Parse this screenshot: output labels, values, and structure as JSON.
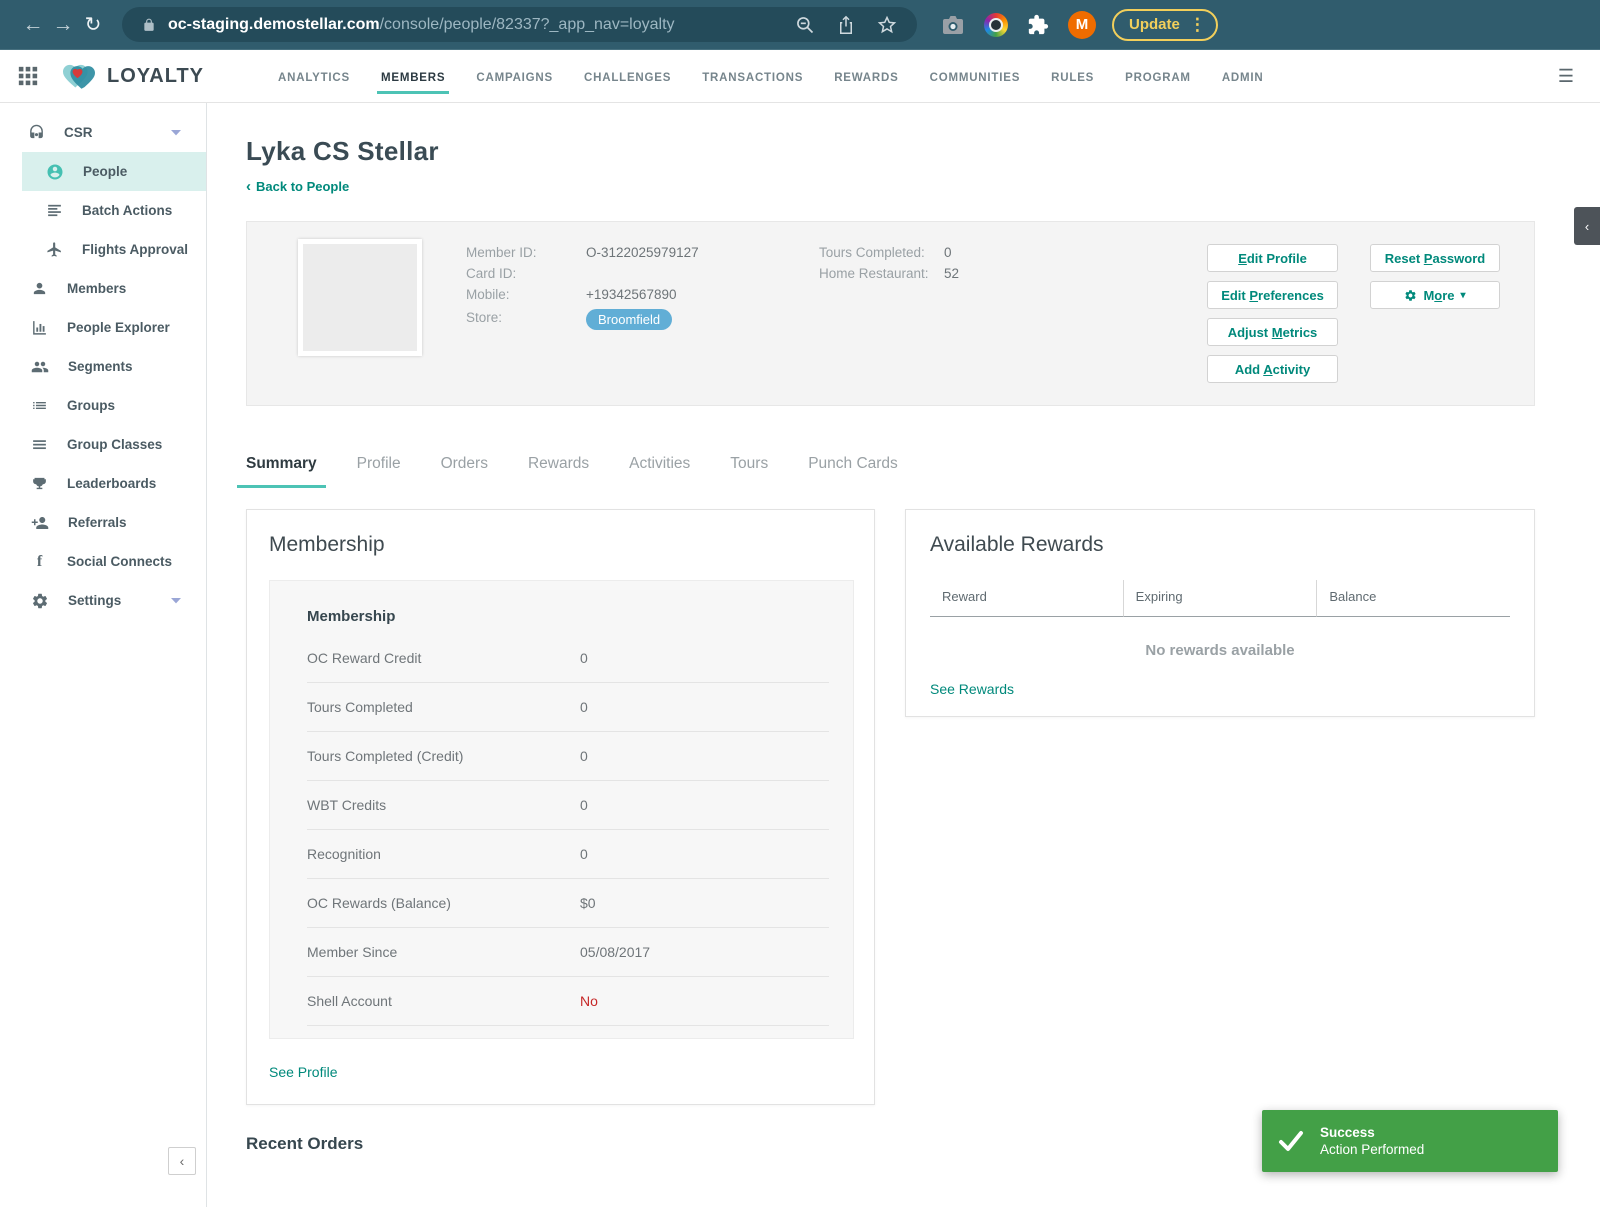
{
  "browser": {
    "url": {
      "domain": "oc-staging.demostellar.com",
      "path": "/console/people/82337?_app_nav=loyalty"
    },
    "profile_initial": "M",
    "update_label": "Update"
  },
  "appbar": {
    "brand": "LOYALTY",
    "nav": [
      {
        "label": "ANALYTICS"
      },
      {
        "label": "MEMBERS"
      },
      {
        "label": "CAMPAIGNS"
      },
      {
        "label": "CHALLENGES"
      },
      {
        "label": "TRANSACTIONS"
      },
      {
        "label": "REWARDS"
      },
      {
        "label": "COMMUNITIES"
      },
      {
        "label": "RULES"
      },
      {
        "label": "PROGRAM"
      },
      {
        "label": "ADMIN"
      }
    ]
  },
  "sidebar": {
    "items": [
      {
        "label": "CSR"
      },
      {
        "label": "People"
      },
      {
        "label": "Batch Actions"
      },
      {
        "label": "Flights Approval"
      },
      {
        "label": "Members"
      },
      {
        "label": "People Explorer"
      },
      {
        "label": "Segments"
      },
      {
        "label": "Groups"
      },
      {
        "label": "Group Classes"
      },
      {
        "label": "Leaderboards"
      },
      {
        "label": "Referrals"
      },
      {
        "label": "Social Connects"
      },
      {
        "label": "Settings"
      }
    ]
  },
  "page": {
    "title": "Lyka CS Stellar",
    "back_link": "Back to People"
  },
  "member": {
    "fields": [
      {
        "label": "Member ID:",
        "value": "O-3122025979127"
      },
      {
        "label": "Card ID:",
        "value": ""
      },
      {
        "label": "Mobile:",
        "value": "+19342567890"
      },
      {
        "label": "Store:",
        "badge": "Broomfield"
      }
    ],
    "stats": [
      {
        "label": "Tours Completed:",
        "value": "0"
      },
      {
        "label": "Home Restaurant:",
        "value": "52"
      }
    ],
    "buttons": {
      "edit_profile": {
        "pre": "",
        "key": "E",
        "post": "dit Profile"
      },
      "edit_preferences": {
        "pre": "Edit ",
        "key": "P",
        "post": "references"
      },
      "adjust_metrics": {
        "pre": "Adjust ",
        "key": "M",
        "post": "etrics"
      },
      "add_activity": {
        "pre": "Add ",
        "key": "A",
        "post": "ctivity"
      },
      "reset_password": {
        "pre": "Reset ",
        "key": "P",
        "post": "assword"
      },
      "more": {
        "pre": "M",
        "key": "o",
        "post": "re"
      }
    }
  },
  "tabs": [
    {
      "label": "Summary"
    },
    {
      "label": "Profile"
    },
    {
      "label": "Orders"
    },
    {
      "label": "Rewards"
    },
    {
      "label": "Activities"
    },
    {
      "label": "Tours"
    },
    {
      "label": "Punch Cards"
    }
  ],
  "membership": {
    "card_title": "Membership",
    "panel_title": "Membership",
    "rows": [
      {
        "label": "OC Reward Credit",
        "value": "0"
      },
      {
        "label": "Tours Completed",
        "value": "0"
      },
      {
        "label": "Tours Completed (Credit)",
        "value": "0"
      },
      {
        "label": "WBT Credits",
        "value": "0"
      },
      {
        "label": "Recognition",
        "value": "0"
      },
      {
        "label": "OC Rewards (Balance)",
        "value": "$0"
      },
      {
        "label": "Member Since",
        "value": "05/08/2017"
      },
      {
        "label": "Shell Account",
        "value": "No"
      }
    ],
    "see_profile": "See Profile"
  },
  "rewards": {
    "title": "Available Rewards",
    "columns": [
      {
        "label": "Reward"
      },
      {
        "label": "Expiring"
      },
      {
        "label": "Balance"
      }
    ],
    "empty_text": "No rewards available",
    "see_rewards": "See Rewards"
  },
  "recent_orders": {
    "title": "Recent Orders"
  },
  "toast": {
    "title": "Success",
    "message": "Action Performed"
  },
  "colors": {
    "accent": "#00897b",
    "accent_underline": "#4dc3b5",
    "store_badge": "#61aed6",
    "success": "#43a047",
    "danger": "#c62828",
    "chrome_bar": "#305c6d",
    "avatar_orange": "#ef6c00"
  }
}
